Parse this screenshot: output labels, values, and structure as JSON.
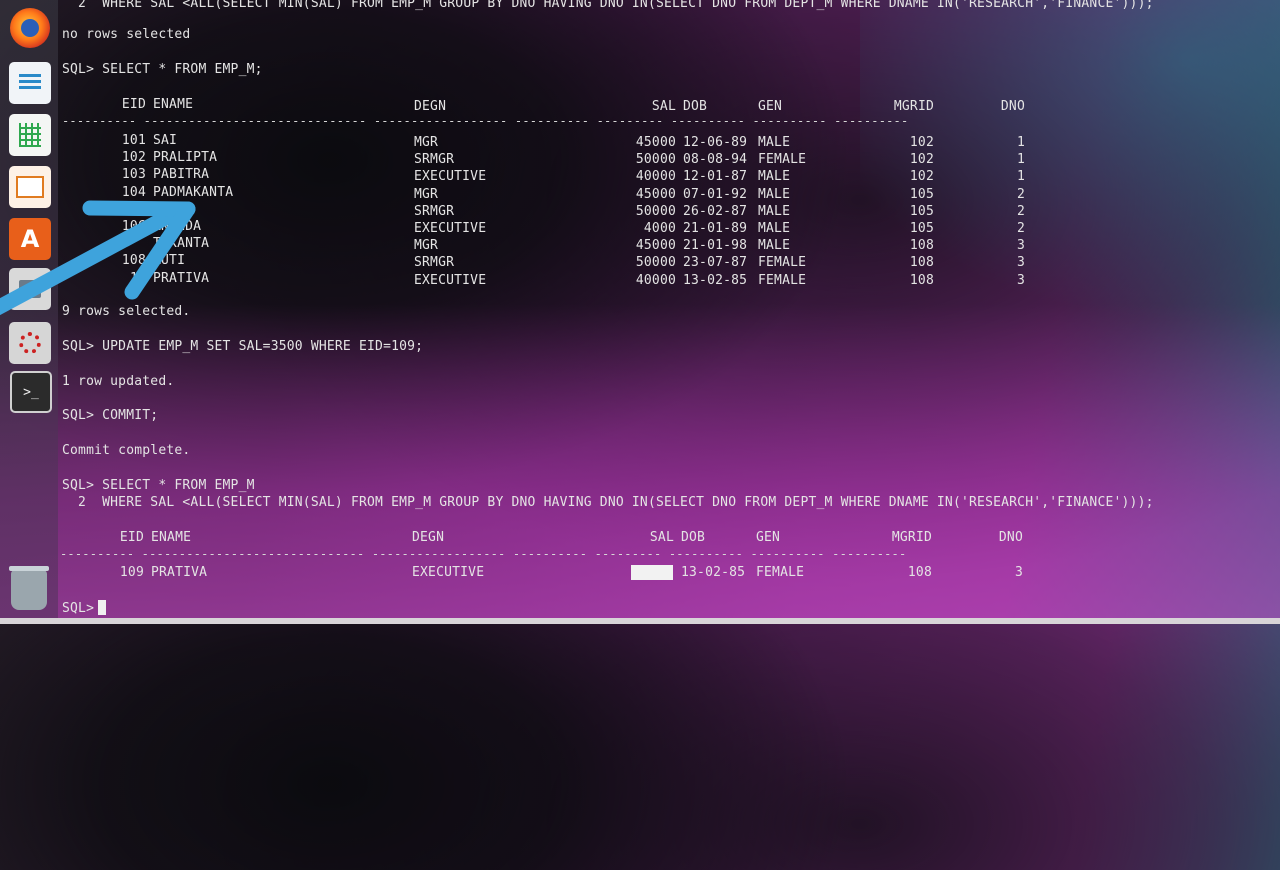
{
  "launcher": {
    "items": [
      {
        "name": "firefox-launcher",
        "icon": "firefox-icon"
      },
      {
        "name": "writer-launcher",
        "icon": "document-icon"
      },
      {
        "name": "calc-launcher",
        "icon": "spreadsheet-icon"
      },
      {
        "name": "impress-launcher",
        "icon": "presentation-icon"
      },
      {
        "name": "software-center-launcher",
        "icon": "store-icon",
        "glyph": "A"
      },
      {
        "name": "app-launcher",
        "icon": "application-icon"
      },
      {
        "name": "settings-launcher",
        "icon": "settings-icon"
      },
      {
        "name": "terminal-launcher",
        "icon": "terminal-icon",
        "glyph": ">_"
      },
      {
        "name": "trash-launcher",
        "icon": "trash-icon"
      }
    ]
  },
  "terminal": {
    "line0": "  2  WHERE SAL <ALL(SELECT MIN(SAL) FROM EMP_M GROUP BY DNO HAVING DNO IN(SELECT DNO FROM DEPT_M WHERE DNAME IN('RESEARCH','FINANCE')));",
    "line1": "no rows selected",
    "line2": "SQL> SELECT * FROM EMP_M;",
    "table1": {
      "headers": [
        "EID",
        "ENAME",
        "DEGN",
        "SAL",
        "DOB",
        "GEN",
        "MGRID",
        "DNO"
      ],
      "separator": "---------- ------------------------------ ------------------ ---------- --------- ---------- ---------- ----------",
      "rows": [
        [
          "101",
          "SAI",
          "MGR",
          "45000",
          "12-06-89",
          "MALE",
          "102",
          "1"
        ],
        [
          "102",
          "PRALIPTA",
          "SRMGR",
          "50000",
          "08-08-94",
          "FEMALE",
          "102",
          "1"
        ],
        [
          "103",
          "PABITRA",
          "EXECUTIVE",
          "40000",
          "12-01-87",
          "MALE",
          "102",
          "1"
        ],
        [
          "104",
          "PADMAKANTA",
          "MGR",
          "45000",
          "07-01-92",
          "MALE",
          "105",
          "2"
        ],
        [
          "",
          "D",
          "SRMGR",
          "50000",
          "26-02-87",
          "MALE",
          "105",
          "2"
        ],
        [
          "106",
          "ANANDA",
          "EXECUTIVE",
          "4000",
          "21-01-89",
          "MALE",
          "105",
          "2"
        ],
        [
          "",
          "TIKANTA",
          "MGR",
          "45000",
          "21-01-98",
          "MALE",
          "108",
          "3"
        ],
        [
          "108",
          "RUTI",
          "SRMGR",
          "50000",
          "23-07-87",
          "FEMALE",
          "108",
          "3"
        ],
        [
          "10",
          "PRATIVA",
          "EXECUTIVE",
          "40000",
          "13-02-85",
          "FEMALE",
          "108",
          "3"
        ]
      ]
    },
    "rows_selected": "9 rows selected.",
    "update_cmd": "SQL> UPDATE EMP_M SET SAL=3500 WHERE EID=109;",
    "update_result": "1 row updated.",
    "commit_cmd": "SQL> COMMIT;",
    "commit_result": "Commit complete.",
    "select_cmd": "SQL> SELECT * FROM EMP_M",
    "select_cmd2": "  2  WHERE SAL <ALL(SELECT MIN(SAL) FROM EMP_M GROUP BY DNO HAVING DNO IN(SELECT DNO FROM DEPT_M WHERE DNAME IN('RESEARCH','FINANCE')));",
    "table2": {
      "headers": [
        "EID",
        "ENAME",
        "DEGN",
        "SAL",
        "DOB",
        "GEN",
        "MGRID",
        "DNO"
      ],
      "separator": "---------- ------------------------------ ------------------ ---------- --------- ---------- ---------- ----------",
      "rows": [
        [
          "109",
          "PRATIVA",
          "EXECUTIVE",
          "",
          "13-02-85",
          "FEMALE",
          "108",
          "3"
        ]
      ]
    },
    "prompt": "SQL>"
  },
  "colors": {
    "text": "#e4e4e4",
    "arrow": "#3ea3dc",
    "background_purple": "#86308a"
  }
}
